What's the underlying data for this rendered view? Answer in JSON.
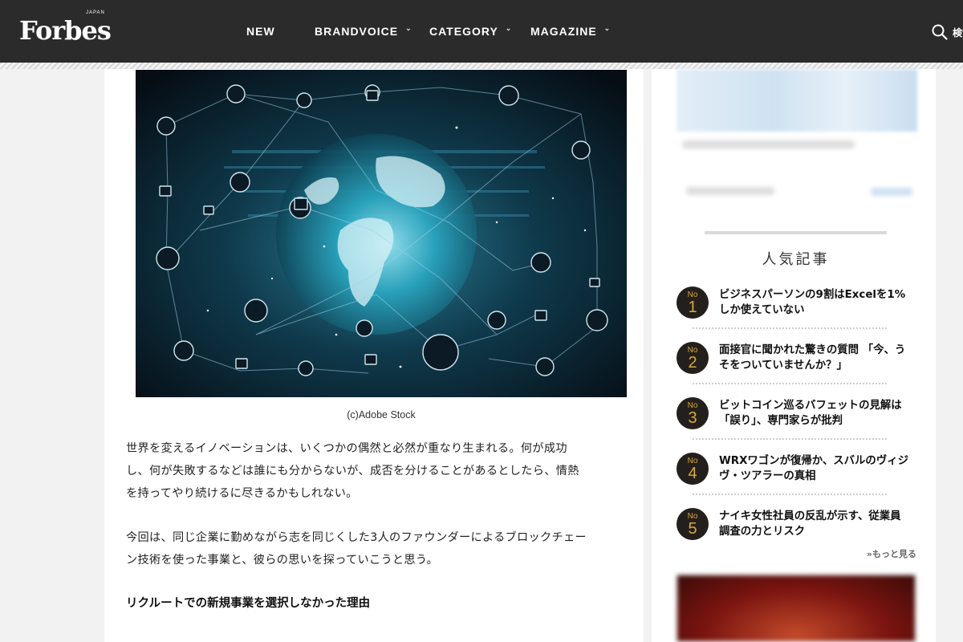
{
  "header": {
    "logo": "Forbes",
    "logo_sub": "JAPAN",
    "nav": [
      {
        "label": "NEW",
        "has_menu": false
      },
      {
        "label": "BRANDVOICE",
        "has_menu": true
      },
      {
        "label": "CATEGORY",
        "has_menu": true
      },
      {
        "label": "MAGAZINE",
        "has_menu": true
      }
    ],
    "search_label": "検索"
  },
  "article": {
    "image_caption": "(c)Adobe Stock",
    "paragraphs": [
      [
        "世界を変えるイノベーションは、いくつかの偶然と必然が重なり生まれる。何が成功",
        "し、何が失敗するなどは誰にも分からないが、成否を分けることがあるとしたら、情熱",
        "を持ってやり続けるに尽きるかもしれない。"
      ],
      [
        "今回は、同じ企業に勤めながら志を同じくした3人のファウンダーによるブロックチェー",
        "ン技術を使った事業と、彼らの思いを探っていこうと思う。"
      ]
    ],
    "subheading": "リクルートでの新規事業を選択しなかった理由"
  },
  "sidebar": {
    "ranking_title": "人気記事",
    "ranking_prefix": "No",
    "ranking": [
      {
        "rank": "1",
        "lines": [
          "ビジネスパーソンの9割はExcelを1%",
          "しか使えていない"
        ]
      },
      {
        "rank": "2",
        "lines": [
          "面接官に聞かれた驚きの質問 「今、う",
          "そをついていませんか？」"
        ]
      },
      {
        "rank": "3",
        "lines": [
          "ビットコイン巡るバフェットの見解は",
          "「誤り」、専門家らが批判"
        ]
      },
      {
        "rank": "4",
        "lines": [
          "WRXワゴンが復帰か、スバルのヴィジ",
          "ヴ・ツアラーの真相"
        ]
      },
      {
        "rank": "5",
        "lines": [
          "ナイキ女性社員の反乱が示す、従業員",
          "調査の力とリスク"
        ]
      }
    ],
    "more_label": "»もっと見る"
  },
  "colors": {
    "header_bg": "#2b2b2b",
    "badge_bg": "#231f1c",
    "badge_text": "#d9a93b"
  }
}
